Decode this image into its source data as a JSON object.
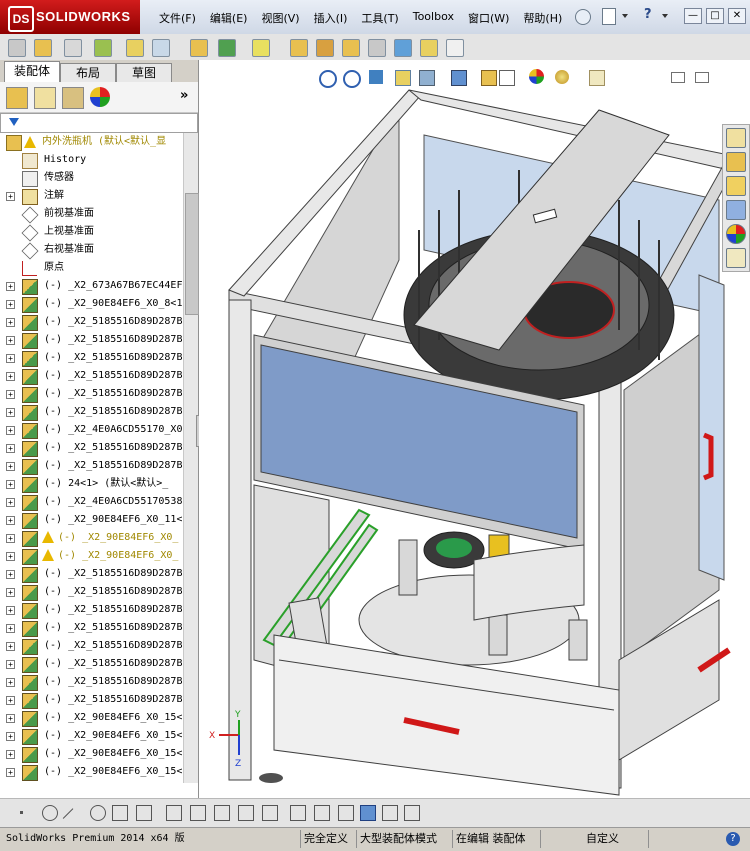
{
  "app": {
    "brand": "SOLIDWORKS",
    "logo_mark": "DS"
  },
  "menu": [
    "文件(F)",
    "编辑(E)",
    "视图(V)",
    "插入(I)",
    "工具(T)",
    "Toolbox",
    "窗口(W)",
    "帮助(H)"
  ],
  "window_controls": {
    "min": "—",
    "max": "□",
    "close": "✕"
  },
  "tabs": [
    {
      "label": "装配体"
    },
    {
      "label": "布局"
    },
    {
      "label": "草图"
    }
  ],
  "panel_expand": "»",
  "tree": {
    "root": "内外洗瓶机  (默认<默认_显",
    "items": [
      {
        "label": "History",
        "icon": "history-icon"
      },
      {
        "label": "传感器",
        "icon": "sensor-icon"
      },
      {
        "label": "注解",
        "icon": "annotation-icon",
        "expand": "+"
      },
      {
        "label": "前视基准面",
        "icon": "plane-icon"
      },
      {
        "label": "上视基准面",
        "icon": "plane-icon"
      },
      {
        "label": "右视基准面",
        "icon": "plane-icon"
      },
      {
        "label": "原点",
        "icon": "origin-icon"
      },
      {
        "label": "(-) _X2_673A67B67EC44EF",
        "expand": "+"
      },
      {
        "label": "(-) _X2_90E84EF6_X0_8<1",
        "expand": "+"
      },
      {
        "label": "(-) _X2_5185516D89D287B",
        "expand": "+"
      },
      {
        "label": "(-) _X2_5185516D89D287B",
        "expand": "+"
      },
      {
        "label": "(-) _X2_5185516D89D287B",
        "expand": "+"
      },
      {
        "label": "(-) _X2_5185516D89D287B",
        "expand": "+"
      },
      {
        "label": "(-) _X2_5185516D89D287B",
        "expand": "+"
      },
      {
        "label": "(-) _X2_5185516D89D287B",
        "expand": "+"
      },
      {
        "label": "(-) _X2_4E0A6CD55170_X0",
        "expand": "+"
      },
      {
        "label": "(-) _X2_5185516D89D287B",
        "expand": "+"
      },
      {
        "label": "(-) _X2_5185516D89D287B",
        "expand": "+"
      },
      {
        "label": "(-) 24<1> (默认<默认>_",
        "expand": "+"
      },
      {
        "label": "(-) _X2_4E0A6CD55170538",
        "expand": "+"
      },
      {
        "label": "(-) _X2_90E84EF6_X0_11<",
        "expand": "+"
      },
      {
        "label": "(-) _X2_90E84EF6_X0_",
        "expand": "+",
        "warn": true
      },
      {
        "label": "(-) _X2_90E84EF6_X0_",
        "expand": "+",
        "warn": true
      },
      {
        "label": "(-) _X2_5185516D89D287B",
        "expand": "+"
      },
      {
        "label": "(-) _X2_5185516D89D287B",
        "expand": "+"
      },
      {
        "label": "(-) _X2_5185516D89D287B",
        "expand": "+"
      },
      {
        "label": "(-) _X2_5185516D89D287B",
        "expand": "+"
      },
      {
        "label": "(-) _X2_5185516D89D287B",
        "expand": "+"
      },
      {
        "label": "(-) _X2_5185516D89D287B",
        "expand": "+"
      },
      {
        "label": "(-) _X2_5185516D89D287B",
        "expand": "+"
      },
      {
        "label": "(-) _X2_5185516D89D287B",
        "expand": "+"
      },
      {
        "label": "(-) _X2_90E84EF6_X0_15<",
        "expand": "+"
      },
      {
        "label": "(-) _X2_90E84EF6_X0_15<",
        "expand": "+"
      },
      {
        "label": "(-) _X2_90E84EF6_X0_15<",
        "expand": "+"
      },
      {
        "label": "(-) _X2_90E84EF6_X0_15<",
        "expand": "+"
      }
    ]
  },
  "triad": {
    "x": "X",
    "y": "Y",
    "z": "Z"
  },
  "status": {
    "version": "SolidWorks Premium 2014 x64 版",
    "defined": "完全定义",
    "mode": "大型装配体模式",
    "editing": "在编辑 装配体",
    "units": "自定义",
    "help": "?"
  },
  "colors": {
    "accent": "#c00000",
    "panel_blue": "#7f9bc8",
    "edge_green": "#2aa02a",
    "handle_red": "#d01818"
  }
}
